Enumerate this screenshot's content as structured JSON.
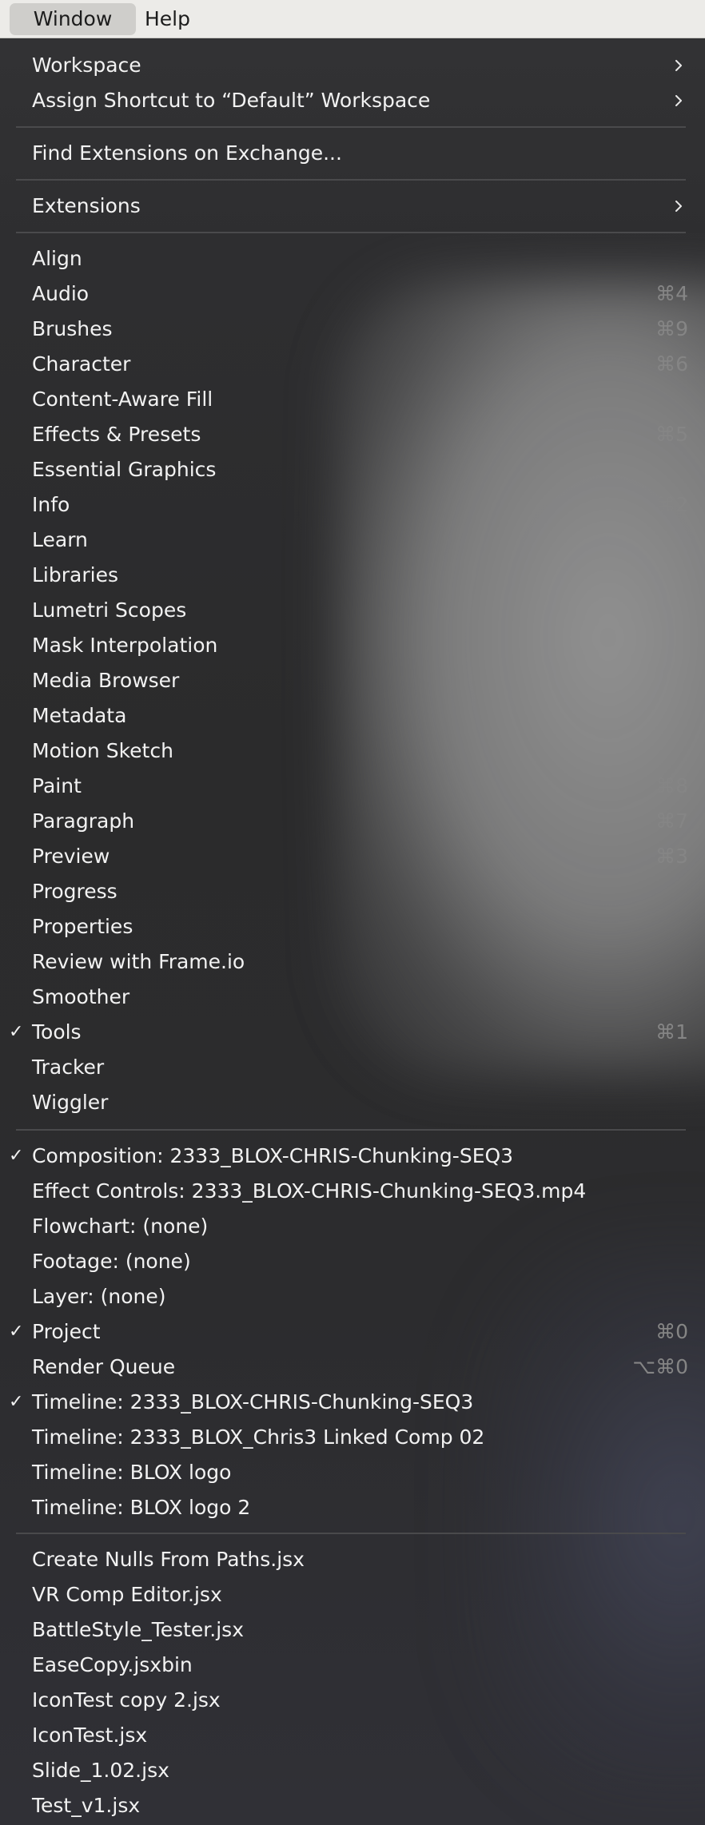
{
  "menubar": {
    "window_label": "Window",
    "help_label": "Help"
  },
  "menu": {
    "workspace": "Workspace",
    "assign_shortcut": "Assign Shortcut to “Default” Workspace",
    "find_extensions": "Find Extensions on Exchange...",
    "extensions": "Extensions",
    "panels": [
      {
        "label": "Align",
        "shortcut": "",
        "checked": false
      },
      {
        "label": "Audio",
        "shortcut": "⌘4",
        "checked": false
      },
      {
        "label": "Brushes",
        "shortcut": "⌘9",
        "checked": false
      },
      {
        "label": "Character",
        "shortcut": "⌘6",
        "checked": false
      },
      {
        "label": "Content-Aware Fill",
        "shortcut": "",
        "checked": false
      },
      {
        "label": "Effects & Presets",
        "shortcut": "⌘5",
        "checked": false
      },
      {
        "label": "Essential Graphics",
        "shortcut": "",
        "checked": false
      },
      {
        "label": "Info",
        "shortcut": "⌘2",
        "checked": false
      },
      {
        "label": "Learn",
        "shortcut": "",
        "checked": false
      },
      {
        "label": "Libraries",
        "shortcut": "",
        "checked": false
      },
      {
        "label": "Lumetri Scopes",
        "shortcut": "",
        "checked": false
      },
      {
        "label": "Mask Interpolation",
        "shortcut": "",
        "checked": false
      },
      {
        "label": "Media Browser",
        "shortcut": "",
        "checked": false
      },
      {
        "label": "Metadata",
        "shortcut": "",
        "checked": false
      },
      {
        "label": "Motion Sketch",
        "shortcut": "",
        "checked": false
      },
      {
        "label": "Paint",
        "shortcut": "⌘8",
        "checked": false
      },
      {
        "label": "Paragraph",
        "shortcut": "⌘7",
        "checked": false
      },
      {
        "label": "Preview",
        "shortcut": "⌘3",
        "checked": false
      },
      {
        "label": "Progress",
        "shortcut": "",
        "checked": false
      },
      {
        "label": "Properties",
        "shortcut": "",
        "checked": false
      },
      {
        "label": "Review with Frame.io",
        "shortcut": "",
        "checked": false
      },
      {
        "label": "Smoother",
        "shortcut": "",
        "checked": false
      },
      {
        "label": "Tools",
        "shortcut": "⌘1",
        "checked": true
      },
      {
        "label": "Tracker",
        "shortcut": "",
        "checked": false
      },
      {
        "label": "Wiggler",
        "shortcut": "",
        "checked": false
      }
    ],
    "viewers": [
      {
        "label": "Composition: 2333_BLOX-CHRIS-Chunking-SEQ3",
        "shortcut": "",
        "checked": true
      },
      {
        "label": "Effect Controls: 2333_BLOX-CHRIS-Chunking-SEQ3.mp4",
        "shortcut": "",
        "checked": false
      },
      {
        "label": "Flowchart: (none)",
        "shortcut": "",
        "checked": false
      },
      {
        "label": "Footage: (none)",
        "shortcut": "",
        "checked": false
      },
      {
        "label": "Layer: (none)",
        "shortcut": "",
        "checked": false
      },
      {
        "label": "Project",
        "shortcut": "⌘0",
        "checked": true
      },
      {
        "label": "Render Queue",
        "shortcut": "⌥⌘0",
        "checked": false
      },
      {
        "label": "Timeline: 2333_BLOX-CHRIS-Chunking-SEQ3",
        "shortcut": "",
        "checked": true
      },
      {
        "label": "Timeline: 2333_BLOX_Chris3 Linked Comp 02",
        "shortcut": "",
        "checked": false
      },
      {
        "label": "Timeline: BLOX logo",
        "shortcut": "",
        "checked": false
      },
      {
        "label": "Timeline: BLOX logo 2",
        "shortcut": "",
        "checked": false
      }
    ],
    "scripts": [
      {
        "label": "Create Nulls From Paths.jsx"
      },
      {
        "label": "VR Comp Editor.jsx"
      },
      {
        "label": "BattleStyle_Tester.jsx"
      },
      {
        "label": "EaseCopy.jsxbin"
      },
      {
        "label": "IconTest copy 2.jsx"
      },
      {
        "label": "IconTest.jsx"
      },
      {
        "label": "Slide_1.02.jsx"
      },
      {
        "label": "Test_v1.jsx"
      }
    ],
    "check_glyph": "✓"
  },
  "colors": {
    "menubar_bg": "#ecebe8",
    "menu_bg": "#2b2b2c",
    "menu_text": "#f2f2f2",
    "shortcut_text": "#858585",
    "separator": "#4a4a4c"
  }
}
